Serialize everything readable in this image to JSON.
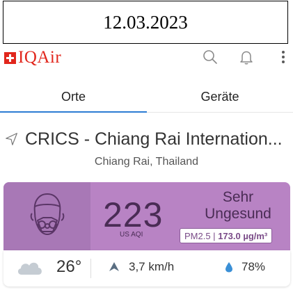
{
  "date_caption": "12.03.2023",
  "app": {
    "brand": "IQAir",
    "colors": {
      "brand_red": "#e1261c",
      "tab_accent": "#2b7cd3",
      "aqi_purple": "#b883c4"
    }
  },
  "toolbar": {
    "icons": [
      "search-icon",
      "bell-icon",
      "more-vert-icon"
    ]
  },
  "tabs": [
    {
      "label": "Orte",
      "active": true
    },
    {
      "label": "Geräte",
      "active": false
    }
  ],
  "station": {
    "name": "CRICS - Chiang Rai Internation...",
    "location": "Chiang Rai, Thailand"
  },
  "aqi": {
    "value": "223",
    "unit": "US AQI",
    "level_line1": "Sehr",
    "level_line2": "Ungesund",
    "pollutant": "PM2.5 |",
    "concentration": "173.0 µg/m³"
  },
  "weather": {
    "temperature": "26°",
    "wind": "3,7 km/h",
    "humidity": "78%"
  }
}
